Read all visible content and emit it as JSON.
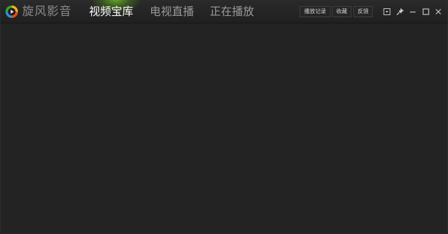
{
  "app": {
    "title": "旋风影音",
    "logo_icon": "qq-player-logo-icon"
  },
  "tabs": [
    {
      "label": "视频宝库",
      "active": true
    },
    {
      "label": "电视直播",
      "active": false
    },
    {
      "label": "正在播放",
      "active": false
    }
  ],
  "toolbar": {
    "history_label": "播放记录",
    "favorites_label": "收藏",
    "feedback_label": "反馈"
  },
  "window_controls": {
    "menu_icon": "dropdown-menu-icon",
    "pin_icon": "pin-icon",
    "minimize_icon": "minimize-icon",
    "maximize_icon": "maximize-icon",
    "close_icon": "close-icon"
  },
  "colors": {
    "background": "#232323",
    "accent_glow": "#78d228",
    "inactive_text": "#9a9a9a",
    "active_text": "#ffffff"
  }
}
